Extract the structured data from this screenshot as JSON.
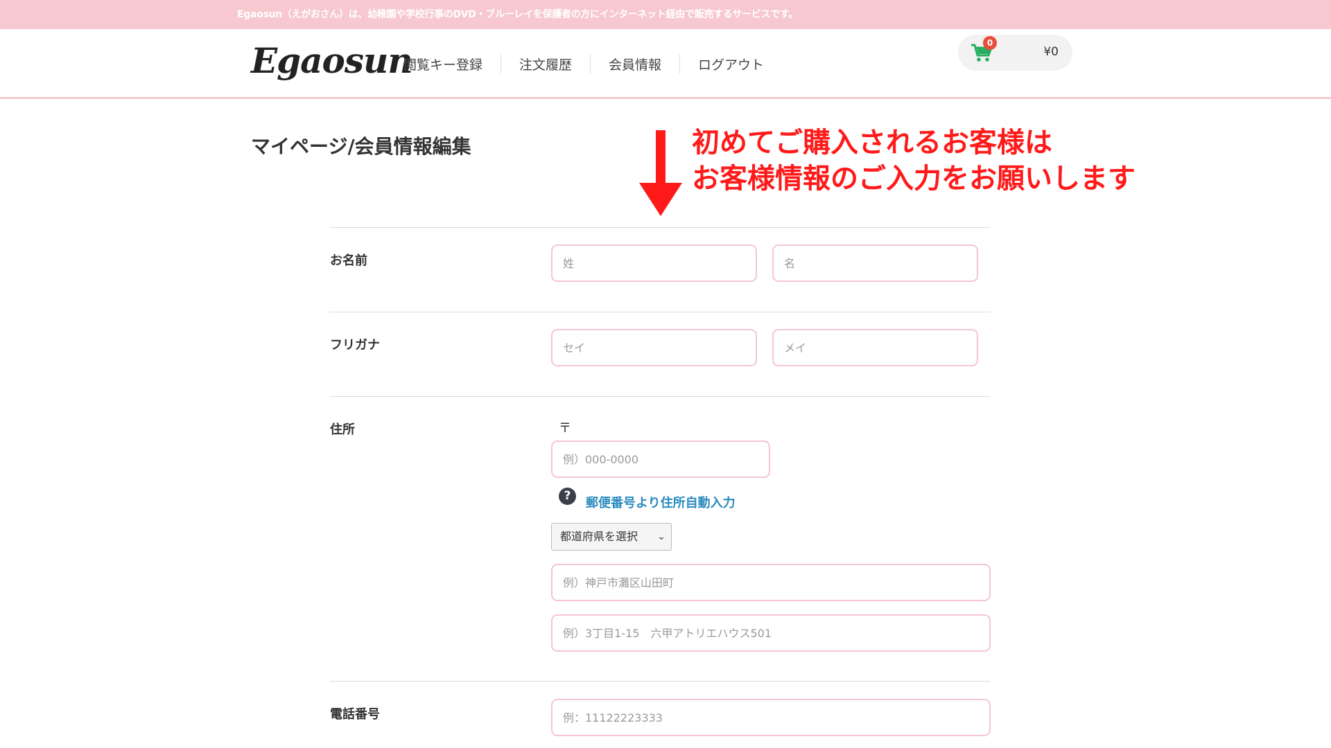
{
  "topbar": {
    "text": "Egaosun（えがおさん）は、幼稚園や学校行事のDVD・ブルーレイを保護者の方にインターネット経由で販売するサービスです。"
  },
  "header": {
    "logo": "Egaosun",
    "nav": [
      "閲覧キー登録",
      "注文履歴",
      "会員情報",
      "ログアウト"
    ],
    "cart": {
      "count": "0",
      "total": "¥0",
      "icon": "cart-icon"
    }
  },
  "page": {
    "title": "マイページ/会員情報編集",
    "notice_line1": "初めてご購入されるお客様は",
    "notice_line2": "お客様情報のご入力をお願いします"
  },
  "form": {
    "name": {
      "label": "お名前",
      "last_placeholder": "姓",
      "first_placeholder": "名"
    },
    "kana": {
      "label": "フリガナ",
      "last_placeholder": "セイ",
      "first_placeholder": "メイ"
    },
    "address": {
      "label": "住所",
      "postal_mark": "〒",
      "postal_placeholder": "例）000-0000",
      "help_icon": "?",
      "auto_link": "郵便番号より住所自動入力",
      "prefecture": "都道府県を選択",
      "city_placeholder": "例）神戸市灘区山田町",
      "street_placeholder": "例）3丁目1-15　六甲アトリエハウス501"
    },
    "phone": {
      "label": "電話番号",
      "placeholder": "例：11122223333"
    }
  },
  "colors": {
    "accent_pink": "#f7c8d0",
    "input_border": "#f5c6cf",
    "notice_red": "#ff1a1a",
    "link_blue": "#2a8bbf",
    "cart_green": "#27ae60",
    "badge_red": "#e74c3c"
  }
}
